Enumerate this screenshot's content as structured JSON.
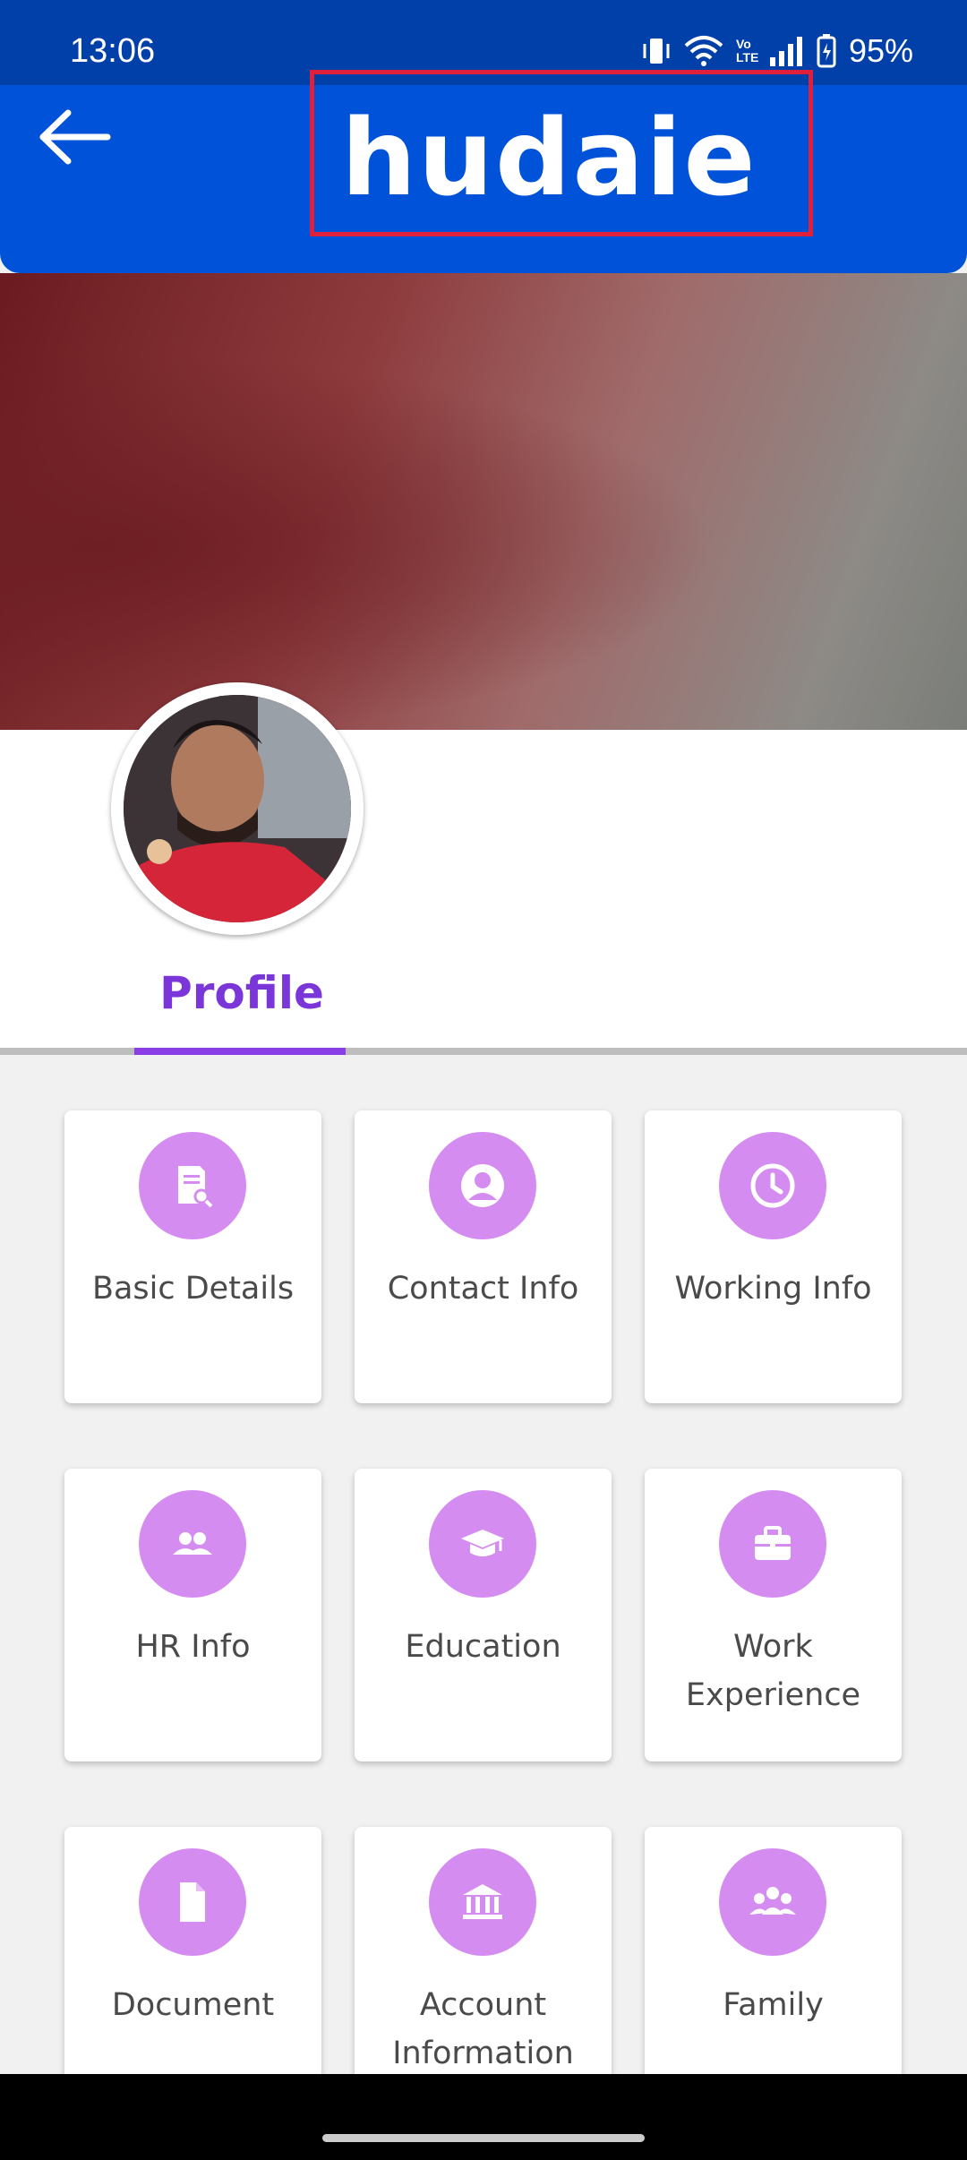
{
  "status_bar": {
    "time": "13:06",
    "battery": "95%",
    "volte": "Vo LTE"
  },
  "header": {
    "logo_text": "hudaie",
    "back_icon": "arrow-left-icon"
  },
  "profile": {
    "tab_label": "Profile"
  },
  "cards": [
    {
      "label": "Basic Details",
      "icon": "document-search-icon"
    },
    {
      "label": "Contact Info",
      "icon": "user-circle-icon"
    },
    {
      "label": "Working Info",
      "icon": "clock-icon"
    },
    {
      "label": "HR Info",
      "icon": "users-icon"
    },
    {
      "label": "Education",
      "icon": "graduation-cap-icon"
    },
    {
      "label": "Work Experience",
      "icon": "briefcase-icon"
    },
    {
      "label": "Document",
      "icon": "file-icon"
    },
    {
      "label": "Account Information",
      "icon": "bank-icon"
    },
    {
      "label": "Family",
      "icon": "family-icon"
    }
  ],
  "colors": {
    "header": "#0052d9",
    "accent": "#7a36d8",
    "icon_bg": "#d58cf0"
  }
}
